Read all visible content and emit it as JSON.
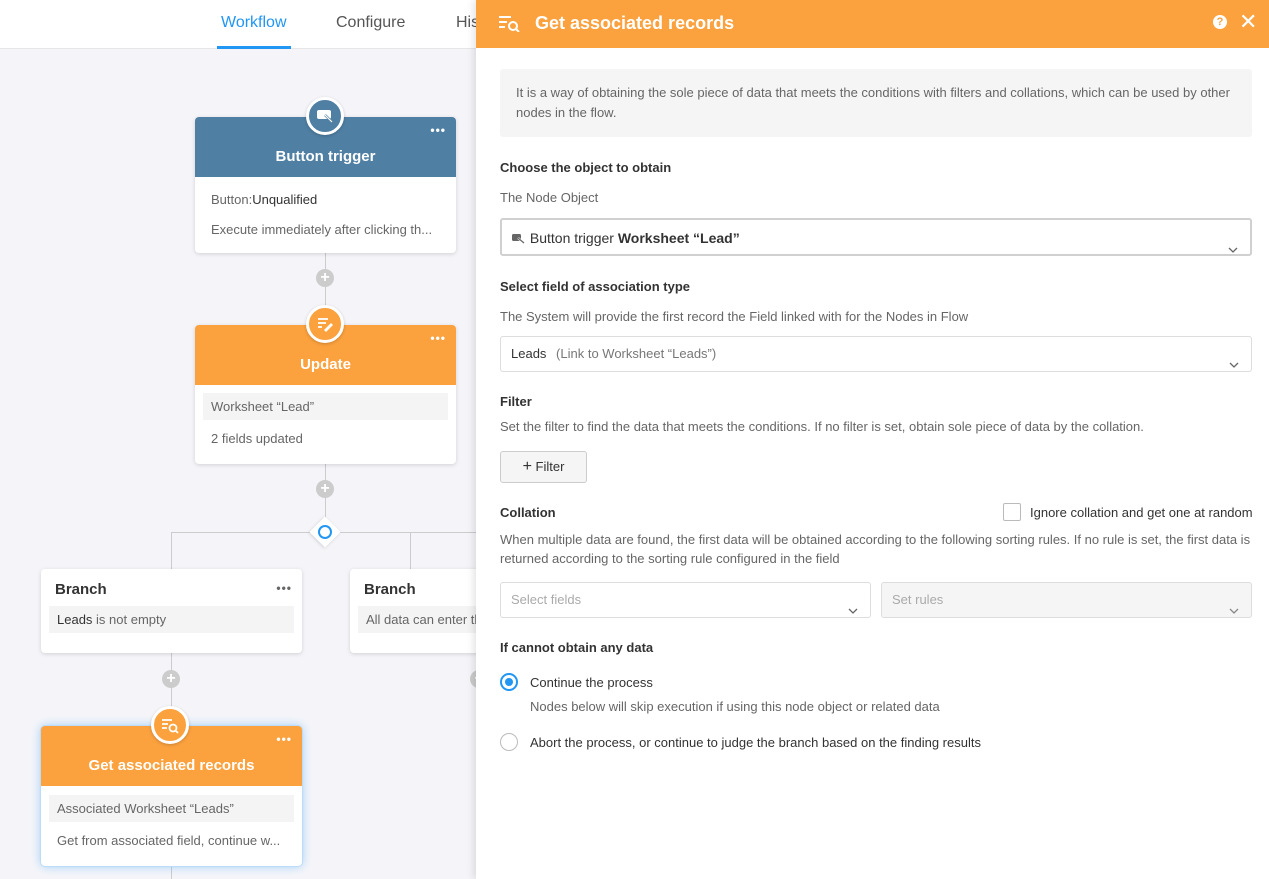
{
  "tabs": [
    {
      "label": "Workflow",
      "active": true
    },
    {
      "label": "Configure",
      "active": false
    },
    {
      "label": "His",
      "active": false
    }
  ],
  "canvas": {
    "trigger_node": {
      "title": "Button trigger",
      "row1_label": "Button:",
      "row1_value": "Unqualified",
      "row2": "Execute immediately after clicking th..."
    },
    "update_node": {
      "title": "Update",
      "row1": "Worksheet “Lead”",
      "row2": "2 fields updated"
    },
    "branch1": {
      "title": "Branch",
      "cond_field": "Leads",
      "cond_text": " is not empty"
    },
    "branch2": {
      "title": "Branch",
      "cond_text": "All data can enter th"
    },
    "get_node": {
      "title": "Get associated records",
      "row1": "Associated Worksheet “Leads”",
      "row2": "Get from associated field, continue w..."
    },
    "more_label": "•••",
    "plus_label": "+"
  },
  "panel": {
    "title": "Get associated records",
    "help_label": "?",
    "close_label": "✕",
    "description": "It is a way of obtaining the sole piece of data that meets the conditions with filters and collations, which can be used by other nodes in the flow.",
    "object_section": {
      "title": "Choose the object to obtain",
      "sub": "The Node Object",
      "select_prefix": "Button trigger ",
      "select_strong": "Worksheet “Lead”"
    },
    "assoc_section": {
      "title": "Select field of association type",
      "sub": "The System will provide the first record the Field linked with for the Nodes in Flow",
      "select_value": "Leads",
      "select_hint": "(Link to Worksheet “Leads”)"
    },
    "filter_section": {
      "title": "Filter",
      "sub": "Set the filter to find the data that meets the conditions. If no filter is set, obtain sole piece of data by the collation.",
      "button_label": "Filter",
      "button_icon": "+"
    },
    "collation_section": {
      "title": "Collation",
      "checkbox_label": "Ignore collation and get one at random",
      "checkbox_checked": false,
      "sub": "When multiple data are found, the first data will be obtained according to the following sorting rules. If no rule is set, the first data is returned according to the sorting rule configured in the field",
      "fields_placeholder": "Select fields",
      "rules_placeholder": "Set rules"
    },
    "nodata_section": {
      "title": "If cannot obtain any data",
      "option1": "Continue the process",
      "option1_sub": "Nodes below will skip execution if using this node object or related data",
      "option1_selected": true,
      "option2": "Abort the process, or continue to judge the branch based on the finding results",
      "option2_selected": false
    }
  },
  "colors": {
    "accent_blue": "#2196f3",
    "orange": "#fba13e",
    "trigger_blue": "#4f7fa3"
  }
}
